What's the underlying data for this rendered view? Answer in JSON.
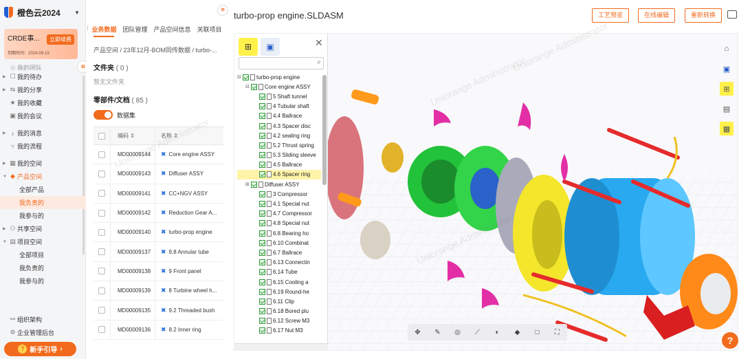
{
  "app": {
    "name": "橙色云2024"
  },
  "promo": {
    "title": "CRDE事...",
    "button": "立即续费",
    "expiry": "到期时间：2024-09-19"
  },
  "nav": {
    "faded_item": "我的团队",
    "items": [
      "我的待办",
      "我的分享",
      "我的收藏",
      "我的会议",
      "我的消息",
      "我的流程",
      "我的空间",
      "产品空间"
    ],
    "product_sub": [
      "全部产品",
      "我负责的",
      "我参与的"
    ],
    "shared": "共享空间",
    "project": "项目空间",
    "project_sub": [
      "全部项目",
      "我负责的",
      "我参与的"
    ],
    "org": "组织架构",
    "admin": "企业管理后台",
    "guide": "新手引导"
  },
  "mid": {
    "tabs": [
      "业务数据",
      "团队管理",
      "产品空间信息",
      "关联项目"
    ],
    "breadcrumb": "产品空间  /  23年12月-BOM同传数据  /  turbo-...",
    "folder_title": "文件夹",
    "folder_count": "( 0 )",
    "folder_empty": "暂无文件夹",
    "parts_title": "零部件/文档",
    "parts_count": "( 85 )",
    "dataset_label": "数据集",
    "col_code": "编码 ⇕",
    "col_name": "名称 ⇕",
    "rows": [
      {
        "code": "MD00009144",
        "name": "Core engine ASSY"
      },
      {
        "code": "MD00009143",
        "name": "Diffuser ASSY"
      },
      {
        "code": "MD00009141",
        "name": "CC+NGV ASSY"
      },
      {
        "code": "MD00009142",
        "name": "Reduction Gear A..."
      },
      {
        "code": "MD00009140",
        "name": "turbo-prop engine"
      },
      {
        "code": "MD00009137",
        "name": "9.8 Annular tube"
      },
      {
        "code": "MD00009138",
        "name": "9 Front panel"
      },
      {
        "code": "MD00009139",
        "name": "8 Turbine wheel h..."
      },
      {
        "code": "MD00009135",
        "name": "9.2 Threaded bush"
      },
      {
        "code": "MD00009136",
        "name": "8.2 Inner ring"
      }
    ]
  },
  "viewer": {
    "title": "turbo-prop engine.SLDASM",
    "btn_draw": "工艺预览",
    "btn_edit": "在线编辑",
    "btn_convert": "重新转换",
    "tree": [
      {
        "label": "turbo-prop engine",
        "level": 0,
        "ex": "⊟"
      },
      {
        "label": "Core engine ASSY",
        "level": 1,
        "ex": "⊟"
      },
      {
        "label": "5 Shaft tunnel",
        "level": 2
      },
      {
        "label": "4 Tubular shaft",
        "level": 2
      },
      {
        "label": "4.4 Ballrace",
        "level": 2
      },
      {
        "label": "4.3 Spacer disc",
        "level": 2
      },
      {
        "label": "4.2 sealing ring",
        "level": 2
      },
      {
        "label": "5.2 Thrust spring",
        "level": 2
      },
      {
        "label": "5.3 Sliding sleeve",
        "level": 2
      },
      {
        "label": "4.5 Ballrace",
        "level": 2
      },
      {
        "label": "4.6 Spacer ring",
        "level": 2,
        "hl": true
      },
      {
        "label": "Diffuser ASSY",
        "level": 1,
        "ex": "⊞"
      },
      {
        "label": "3 Compressor",
        "level": 2
      },
      {
        "label": "4.1 Special nut",
        "level": 2
      },
      {
        "label": "4.7 Compressor",
        "level": 2
      },
      {
        "label": "4.8 Special nut",
        "level": 2
      },
      {
        "label": "6.8 Bearing ho",
        "level": 2
      },
      {
        "label": "6.10 Combinat",
        "level": 2
      },
      {
        "label": "6.7 Ballrace",
        "level": 2
      },
      {
        "label": "6.13 Connectin",
        "level": 2
      },
      {
        "label": "6.14 Tube",
        "level": 2
      },
      {
        "label": "6.15 Cooling a",
        "level": 2
      },
      {
        "label": "6.19 Round-he",
        "level": 2
      },
      {
        "label": "6.11 Clip",
        "level": 2
      },
      {
        "label": "6.18 Bored plu",
        "level": 2
      },
      {
        "label": "6.12 Screw M3",
        "level": 2
      },
      {
        "label": "6.17 Nut M3",
        "level": 2
      }
    ],
    "tools": [
      "home-icon",
      "view-cube-icon",
      "tree-icon",
      "properties-icon",
      "parts-list-icon"
    ],
    "bottom_tools": [
      "explode-icon",
      "annotation-icon",
      "section-icon",
      "measure-icon",
      "color-icon",
      "model-icon",
      "box-icon",
      "fullscreen-icon"
    ]
  },
  "watermark": "Uniorange Administrator",
  "colors": {
    "brand": "#f26b1d",
    "green": "#2e9b3a"
  }
}
